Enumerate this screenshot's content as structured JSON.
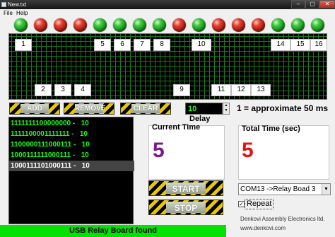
{
  "window": {
    "title": "New.txt",
    "minimize": "–",
    "maximize": "▢",
    "close": "✕"
  },
  "menu": [
    "File",
    "Help"
  ],
  "relays": [
    {
      "label": "1",
      "on": true
    },
    {
      "label": "2",
      "on": false
    },
    {
      "label": "3",
      "on": false
    },
    {
      "label": "4",
      "on": false
    },
    {
      "label": "5",
      "on": true
    },
    {
      "label": "6",
      "on": true
    },
    {
      "label": "7",
      "on": true
    },
    {
      "label": "8",
      "on": true
    },
    {
      "label": "9",
      "on": false
    },
    {
      "label": "10",
      "on": true
    },
    {
      "label": "11",
      "on": false
    },
    {
      "label": "12",
      "on": false
    },
    {
      "label": "13",
      "on": false
    },
    {
      "label": "14",
      "on": true
    },
    {
      "label": "15",
      "on": true
    },
    {
      "label": "16",
      "on": true
    }
  ],
  "buttons": {
    "add": "ADD",
    "remove": "REMOVE",
    "clear": "CLEAR",
    "start": "START",
    "stop": "STOP"
  },
  "delay": {
    "value": "10",
    "label": "Delay",
    "note": "1 = approximate 50 ms",
    "spin_up": "▲",
    "spin_down": "▼"
  },
  "sequence": [
    "1111111100000000 -   10",
    "1111100001111111 -   10",
    "1100000111000111 -   10",
    "1000111111000111 -   10",
    "1000111101000111 -   10"
  ],
  "selected_index": 4,
  "current_time": {
    "label": "Current Time",
    "value": "5",
    "color": "#7a1a8a"
  },
  "total_time": {
    "label": "Total Time (sec)",
    "value": "5",
    "color": "#e81010"
  },
  "port": {
    "selected": "COM13 ->Relay Boad 3",
    "arrow": "▼"
  },
  "repeat": {
    "label": "Repeat",
    "checked": true,
    "mark": "✓"
  },
  "credits": {
    "company": "Denkovi Assembly Electronics ltd.",
    "url": "www.denkovi.com"
  },
  "status": "USB Relay Board found",
  "colors": {
    "led_on": "#35c435",
    "led_off": "#e23a2a",
    "list_text": "#18ff18",
    "status_bg": "#05e005"
  }
}
